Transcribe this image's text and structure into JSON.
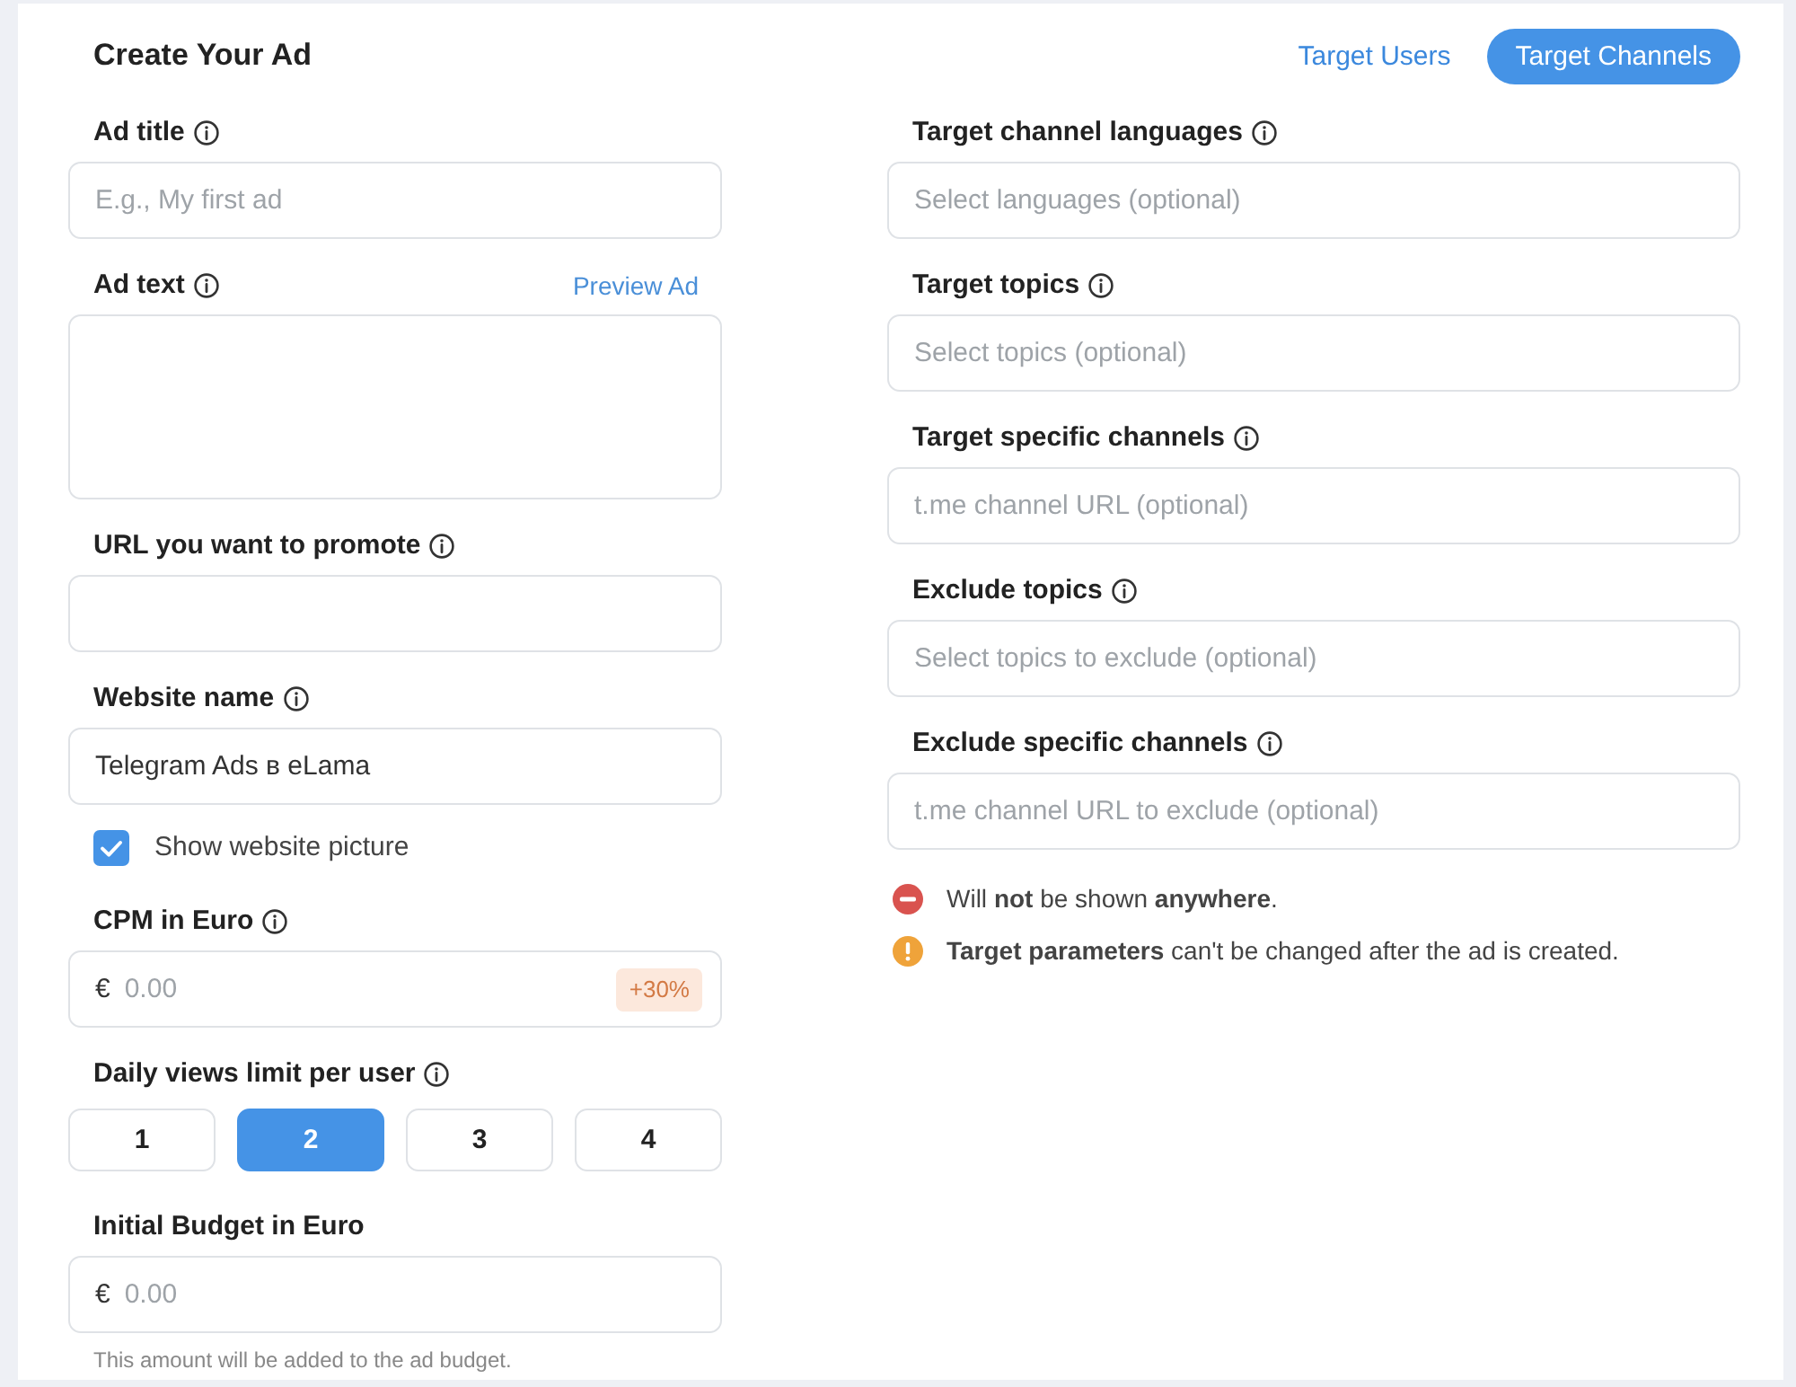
{
  "header": {
    "title": "Create Your Ad",
    "tabs": [
      {
        "label": "Target Users",
        "selected": false
      },
      {
        "label": "Target Channels",
        "selected": true
      }
    ]
  },
  "ad_fields": [
    {
      "kind": "input",
      "label": "Ad title",
      "info": true,
      "placeholder": "E.g., My first ad"
    },
    {
      "kind": "textarea",
      "label": "Ad text",
      "info": true,
      "link": "Preview Ad"
    },
    {
      "kind": "input",
      "label": "URL you want to promote",
      "info": true
    },
    {
      "kind": "input",
      "label": "Website name",
      "info": true,
      "value": "Telegram Ads в eLama"
    },
    {
      "kind": "checkbox",
      "label": "Show website picture",
      "checked": true
    },
    {
      "kind": "money",
      "label": "CPM in Euro",
      "info": true,
      "currency": "€",
      "placeholder": "0.00",
      "badge": "+30%"
    },
    {
      "kind": "choice",
      "label": "Daily views limit per user",
      "info": true,
      "options": [
        {
          "label": "1",
          "selected": false
        },
        {
          "label": "2",
          "selected": true
        },
        {
          "label": "3",
          "selected": false
        },
        {
          "label": "4",
          "selected": false
        }
      ]
    },
    {
      "kind": "money",
      "label": "Initial Budget in Euro",
      "info": false,
      "currency": "€",
      "placeholder": "0.00",
      "note": "This amount will be added to the ad budget."
    }
  ],
  "targeting_fields": [
    {
      "label": "Target channel languages",
      "info": true,
      "placeholder": "Select languages (optional)"
    },
    {
      "label": "Target topics",
      "info": true,
      "placeholder": "Select topics (optional)"
    },
    {
      "label": "Target specific channels",
      "info": true,
      "placeholder": "t.me channel URL (optional)"
    },
    {
      "label": "Exclude topics",
      "info": true,
      "placeholder": "Select topics to exclude (optional)"
    },
    {
      "label": "Exclude specific channels",
      "info": true,
      "placeholder": "t.me channel URL to exclude (optional)"
    }
  ],
  "notices": [
    {
      "kind": "error",
      "text": "Will **not** be shown **anywhere**."
    },
    {
      "kind": "warning",
      "text": "**Target parameters** can't be changed after the ad is created."
    }
  ]
}
